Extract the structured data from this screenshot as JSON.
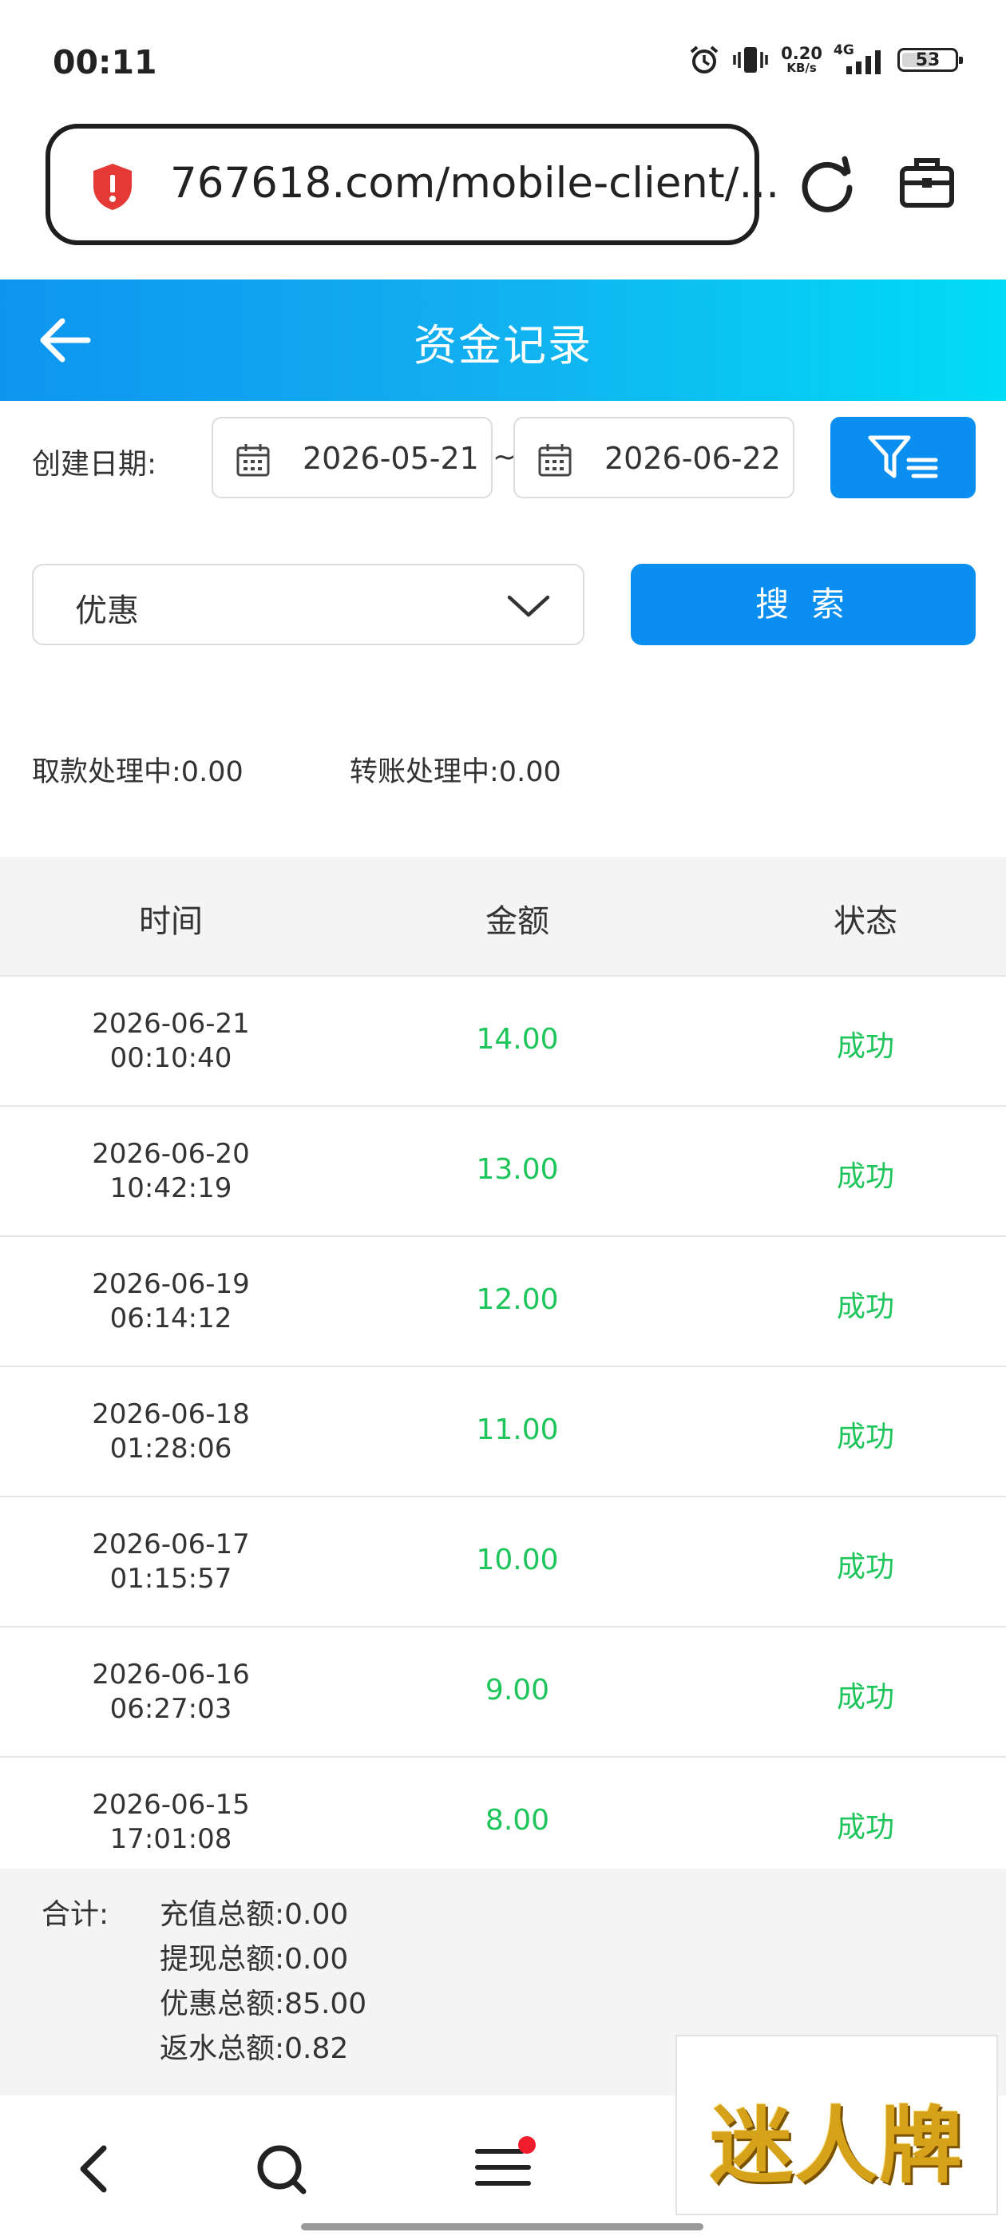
{
  "status_bar": {
    "time": "00:11",
    "net_speed_value": "0.20",
    "net_speed_unit": "KB/s",
    "network": "4G",
    "battery": "53"
  },
  "browser": {
    "url": "767618.com/mobile-client/..."
  },
  "header": {
    "title": "资金记录"
  },
  "filter": {
    "date_label": "创建日期:",
    "start_date": "2026-05-21",
    "separator": "~",
    "end_date": "2026-06-22",
    "type_selected": "优惠",
    "search_label": "搜 索"
  },
  "processing": {
    "withdraw_label": "取款处理中:",
    "withdraw_value": "0.00",
    "transfer_label": "转账处理中:",
    "transfer_value": "0.00"
  },
  "table": {
    "headers": [
      "时间",
      "金额",
      "状态"
    ],
    "rows": [
      {
        "date": "2026-06-21",
        "time": "00:10:40",
        "amount": "14.00",
        "status": "成功"
      },
      {
        "date": "2026-06-20",
        "time": "10:42:19",
        "amount": "13.00",
        "status": "成功"
      },
      {
        "date": "2026-06-19",
        "time": "06:14:12",
        "amount": "12.00",
        "status": "成功"
      },
      {
        "date": "2026-06-18",
        "time": "01:28:06",
        "amount": "11.00",
        "status": "成功"
      },
      {
        "date": "2026-06-17",
        "time": "01:15:57",
        "amount": "10.00",
        "status": "成功"
      },
      {
        "date": "2026-06-16",
        "time": "06:27:03",
        "amount": "9.00",
        "status": "成功"
      },
      {
        "date": "2026-06-15",
        "time": "17:01:08",
        "amount": "8.00",
        "status": "成功"
      }
    ]
  },
  "totals": {
    "label": "合计:",
    "items": [
      {
        "label": "充值总额:",
        "value": "0.00"
      },
      {
        "label": "提现总额:",
        "value": "0.00"
      },
      {
        "label": "优惠总额:",
        "value": "85.00"
      },
      {
        "label": "返水总额:",
        "value": "0.82"
      }
    ]
  },
  "watermark": {
    "text": "迷人牌"
  },
  "colors": {
    "accent": "#0a8ef0",
    "success": "#1ec55a",
    "header_start": "#0e95f0",
    "header_end": "#00dcf6"
  }
}
